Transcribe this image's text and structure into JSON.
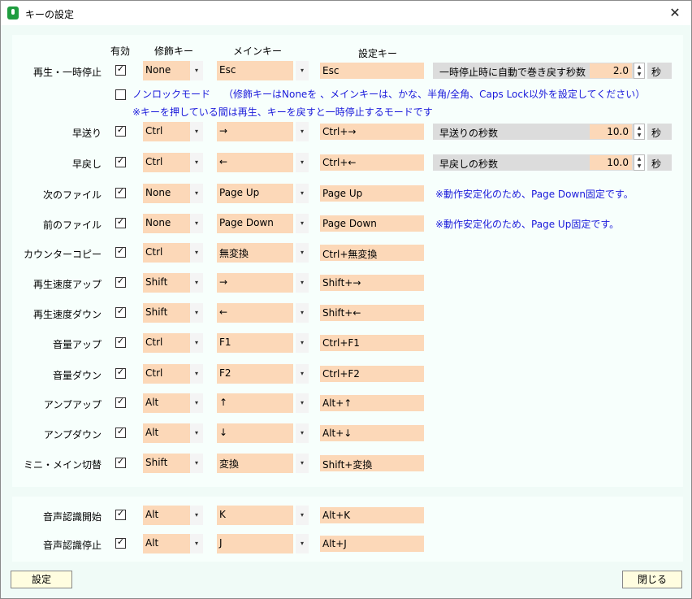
{
  "window": {
    "title": "キーの設定"
  },
  "headers": {
    "enabled": "有効",
    "modifier": "修飾キー",
    "main": "メインキー",
    "set": "設定キー"
  },
  "rows": [
    {
      "label": "再生・一時停止",
      "enabled": true,
      "modifier": "None",
      "main": "Esc",
      "set": "Esc"
    },
    {
      "label": "早送り",
      "enabled": true,
      "modifier": "Ctrl",
      "main": "→",
      "set": "Ctrl+→"
    },
    {
      "label": "早戻し",
      "enabled": true,
      "modifier": "Ctrl",
      "main": "←",
      "set": "Ctrl+←"
    },
    {
      "label": "次のファイル",
      "enabled": true,
      "modifier": "None",
      "main": "Page Up",
      "set": "Page Up"
    },
    {
      "label": "前のファイル",
      "enabled": true,
      "modifier": "None",
      "main": "Page Down",
      "set": "Page Down"
    },
    {
      "label": "カウンターコピー",
      "enabled": true,
      "modifier": "Ctrl",
      "main": "無変換",
      "set": "Ctrl+無変換"
    },
    {
      "label": "再生速度アップ",
      "enabled": true,
      "modifier": "Shift",
      "main": "→",
      "set": "Shift+→"
    },
    {
      "label": "再生速度ダウン",
      "enabled": true,
      "modifier": "Shift",
      "main": "←",
      "set": "Shift+←"
    },
    {
      "label": "音量アップ",
      "enabled": true,
      "modifier": "Ctrl",
      "main": "F1",
      "set": "Ctrl+F1"
    },
    {
      "label": "音量ダウン",
      "enabled": true,
      "modifier": "Ctrl",
      "main": "F2",
      "set": "Ctrl+F2"
    },
    {
      "label": "アンプアップ",
      "enabled": true,
      "modifier": "Alt",
      "main": "↑",
      "set": "Alt+↑"
    },
    {
      "label": "アンプダウン",
      "enabled": true,
      "modifier": "Alt",
      "main": "↓",
      "set": "Alt+↓"
    },
    {
      "label": "ミニ・メイン切替",
      "enabled": true,
      "modifier": "Shift",
      "main": "変換",
      "set": "Shift+変換"
    }
  ],
  "speech_rows": [
    {
      "label": "音声認識開始",
      "enabled": true,
      "modifier": "Alt",
      "main": "K",
      "set": "Alt+K"
    },
    {
      "label": "音声認識停止",
      "enabled": true,
      "modifier": "Alt",
      "main": "J",
      "set": "Alt+J"
    }
  ],
  "pause_rewind": {
    "label": "一時停止時に自動で巻き戻す秒数",
    "value": "2.0",
    "unit": "秒"
  },
  "forward_secs": {
    "label": "早送りの秒数",
    "value": "10.0",
    "unit": "秒"
  },
  "rewind_secs": {
    "label": "早戻しの秒数",
    "value": "10.0",
    "unit": "秒"
  },
  "nonlock": {
    "enabled": false,
    "label": "ノンロックモード",
    "hint": "（修飾キーはNoneを 、メインキーは、かな、半角/全角、Caps Lock以外を設定してください）",
    "note": "※キーを押している間は再生、キーを戻すと一時停止するモードです"
  },
  "notes": {
    "next_file": "※動作安定化のため、Page Down固定です。",
    "prev_file": "※動作安定化のため、Page Up固定です。"
  },
  "buttons": {
    "apply": "設定",
    "close": "閉じる"
  },
  "glyphs": {
    "check": "✓",
    "dropdown": "▾",
    "spin_up": "▲",
    "spin_down": "▼",
    "close": "✕"
  }
}
